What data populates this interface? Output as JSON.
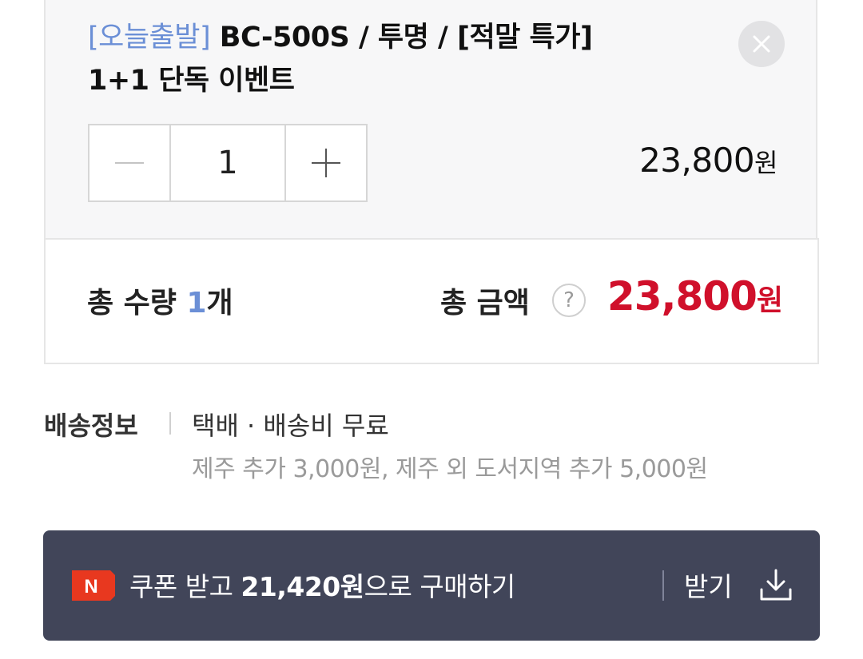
{
  "option": {
    "tag": "[오늘출발]",
    "title": " BC-500S / 투명 / [적말 특가]",
    "title_line2": "1+1 단독 이벤트",
    "quantity": "1",
    "price": "23,800",
    "price_unit": "원"
  },
  "total": {
    "qty_label": "총 수량 ",
    "qty_value": "1",
    "qty_unit": "개",
    "amount_label": "총 금액",
    "help": "?",
    "amount": "23,800",
    "amount_unit": "원"
  },
  "delivery": {
    "label": "배송정보",
    "main": "택배 · 배송비 무료",
    "sub": "제주 추가 3,000원, 제주 외 도서지역 추가 5,000원"
  },
  "coupon": {
    "logo_letter": "N",
    "text_prefix": "쿠폰 받고 ",
    "amount": "21,420원",
    "text_suffix": "으로 구매하기",
    "receive_label": "받기"
  },
  "colors": {
    "accent_blue": "#6b8fd6",
    "price_red": "#d0102b",
    "banner_bg": "#414559",
    "logo_red": "#e8381f"
  },
  "icons": {
    "close": "close-icon",
    "minus": "minus-icon",
    "plus": "plus-icon",
    "help": "question-circle-icon",
    "logo": "naver-n-logo",
    "download": "download-icon"
  }
}
